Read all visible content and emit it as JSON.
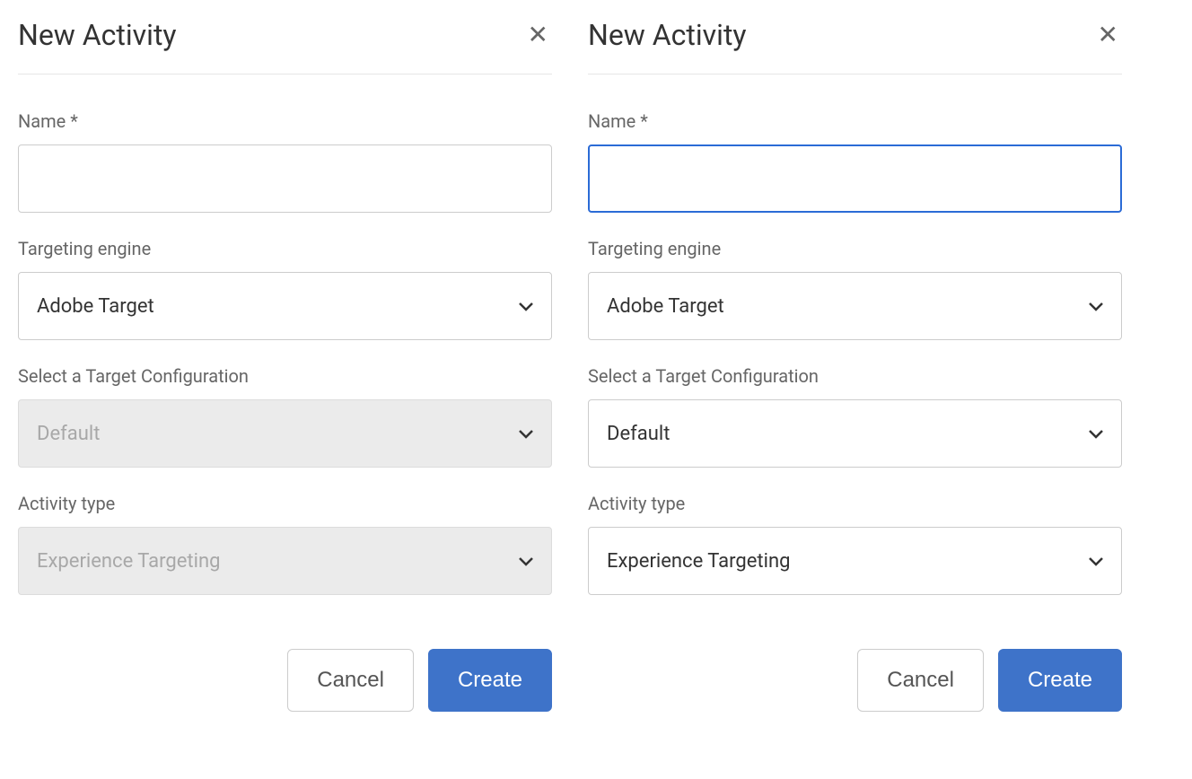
{
  "dialog1": {
    "title": "New Activity",
    "fields": {
      "name": {
        "label": "Name *",
        "value": ""
      },
      "engine": {
        "label": "Targeting engine",
        "value": "Adobe Target"
      },
      "config": {
        "label": "Select a Target Configuration",
        "value": "Default"
      },
      "type": {
        "label": "Activity type",
        "value": "Experience Targeting"
      }
    },
    "buttons": {
      "cancel": "Cancel",
      "create": "Create"
    }
  },
  "dialog2": {
    "title": "New Activity",
    "fields": {
      "name": {
        "label": "Name *",
        "value": ""
      },
      "engine": {
        "label": "Targeting engine",
        "value": "Adobe Target"
      },
      "config": {
        "label": "Select a Target Configuration",
        "value": "Default"
      },
      "type": {
        "label": "Activity type",
        "value": "Experience Targeting"
      }
    },
    "buttons": {
      "cancel": "Cancel",
      "create": "Create"
    }
  }
}
